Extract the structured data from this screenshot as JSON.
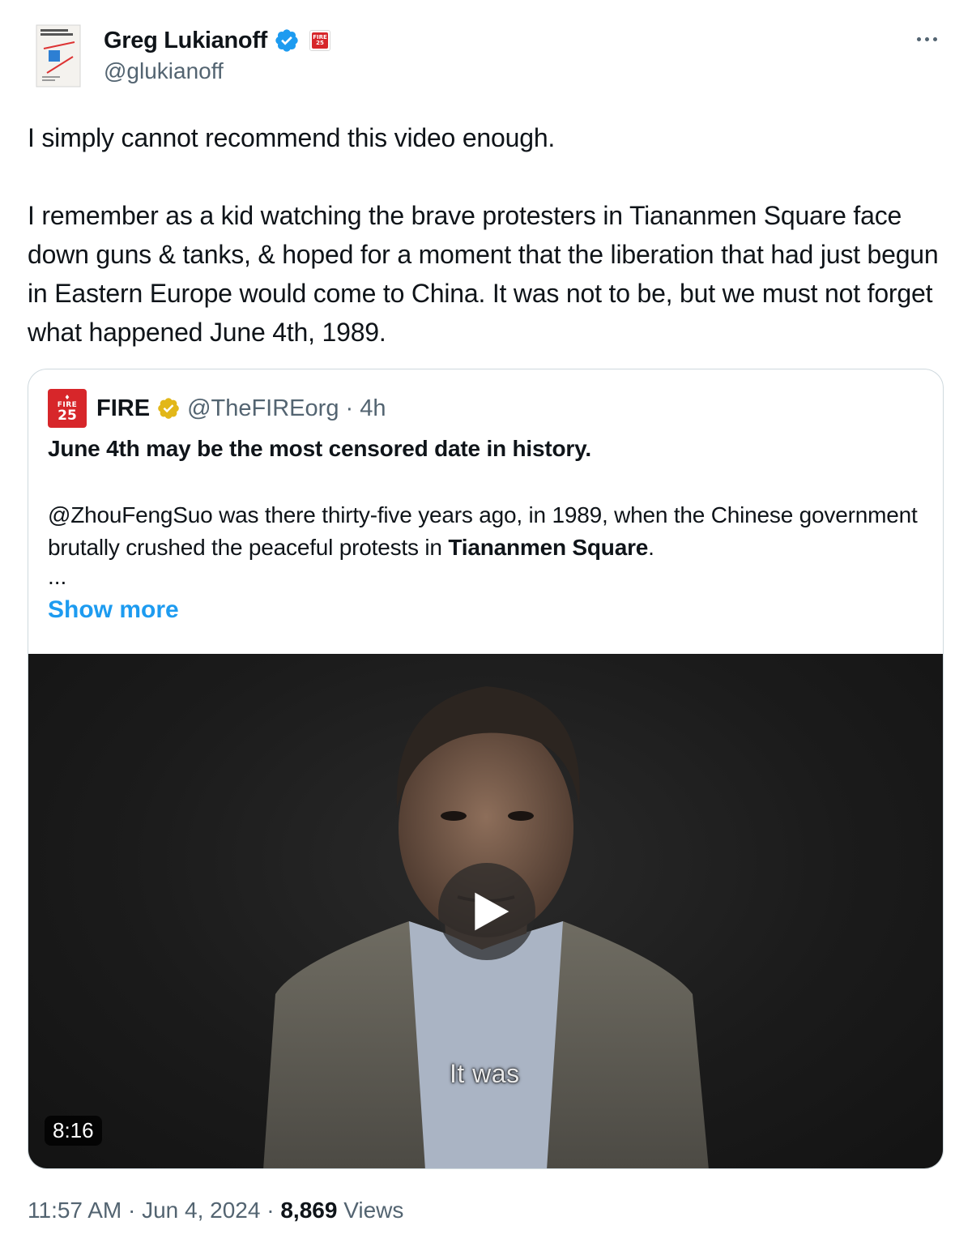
{
  "author": {
    "display_name": "Greg Lukianoff",
    "handle": "@glukianoff",
    "affiliate_badge_text": "FIRE 25"
  },
  "tweet": {
    "paragraphs": [
      "I simply cannot recommend this video enough.",
      "I remember as a kid watching the brave protesters in Tiananmen Square face down guns & tanks, & hoped for a moment that the liberation that had just begun in Eastern Europe would come to China. It was not to be, but we must not forget what happened June 4th, 1989."
    ]
  },
  "quote": {
    "avatar_text_top": "FIRE",
    "avatar_text_num": "25",
    "display_name": "FIRE",
    "handle_time": "@TheFIREorg · 4h",
    "headline": "June 4th may be the most censored date in history.",
    "body_prefix": "@ZhouFengSuo was there thirty-five years ago, in 1989, when the Chinese government brutally crushed the peaceful protests in ",
    "body_bold": "Tiananmen Square",
    "body_suffix": ".",
    "ellipsis": "...",
    "show_more": "Show more"
  },
  "video": {
    "subtitle": "It was",
    "duration": "8:16"
  },
  "meta": {
    "time_date": "11:57 AM · Jun 4, 2024 · ",
    "views_count": "8,869",
    "views_label": " Views"
  },
  "colors": {
    "verified_blue": "#1d9bf0",
    "gold_badge": "#e2b719",
    "fire_red": "#d7262a",
    "link_blue": "#1d9bf0",
    "secondary_text": "#536471"
  },
  "icons": [
    "book-cover-avatar",
    "verified-icon",
    "affiliate-badge",
    "more-icon",
    "gold-verified-icon",
    "play-icon"
  ]
}
